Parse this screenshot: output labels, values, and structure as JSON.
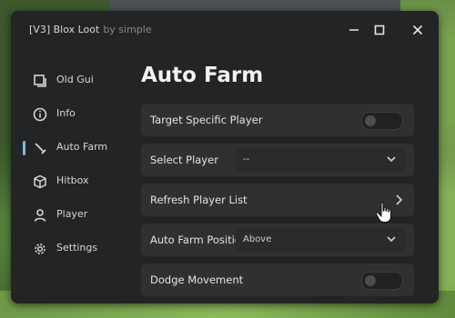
{
  "window": {
    "title": "[V3] Blox Loot",
    "subtitle": "by simple"
  },
  "sidebar": {
    "items": [
      {
        "label": "Old Gui",
        "icon": "old-gui-icon"
      },
      {
        "label": "Info",
        "icon": "info-icon"
      },
      {
        "label": "Auto Farm",
        "icon": "sword-icon",
        "active": true
      },
      {
        "label": "Hitbox",
        "icon": "cube-icon"
      },
      {
        "label": "Player",
        "icon": "user-icon"
      },
      {
        "label": "Settings",
        "icon": "gear-icon"
      }
    ]
  },
  "main": {
    "title": "Auto Farm",
    "rows": [
      {
        "label": "Target Specific Player",
        "type": "toggle",
        "on": false
      },
      {
        "label": "Select Player",
        "type": "dropdown",
        "value": "--"
      },
      {
        "label": "Refresh Player List",
        "type": "button"
      },
      {
        "label": "Auto Farm Position",
        "type": "dropdown",
        "value": "Above"
      },
      {
        "label": "Dodge Movement",
        "type": "toggle",
        "on": false
      }
    ]
  },
  "colors": {
    "window_bg": "#232425",
    "row_bg": "#2f3031",
    "accent": "#7fb8e8"
  }
}
